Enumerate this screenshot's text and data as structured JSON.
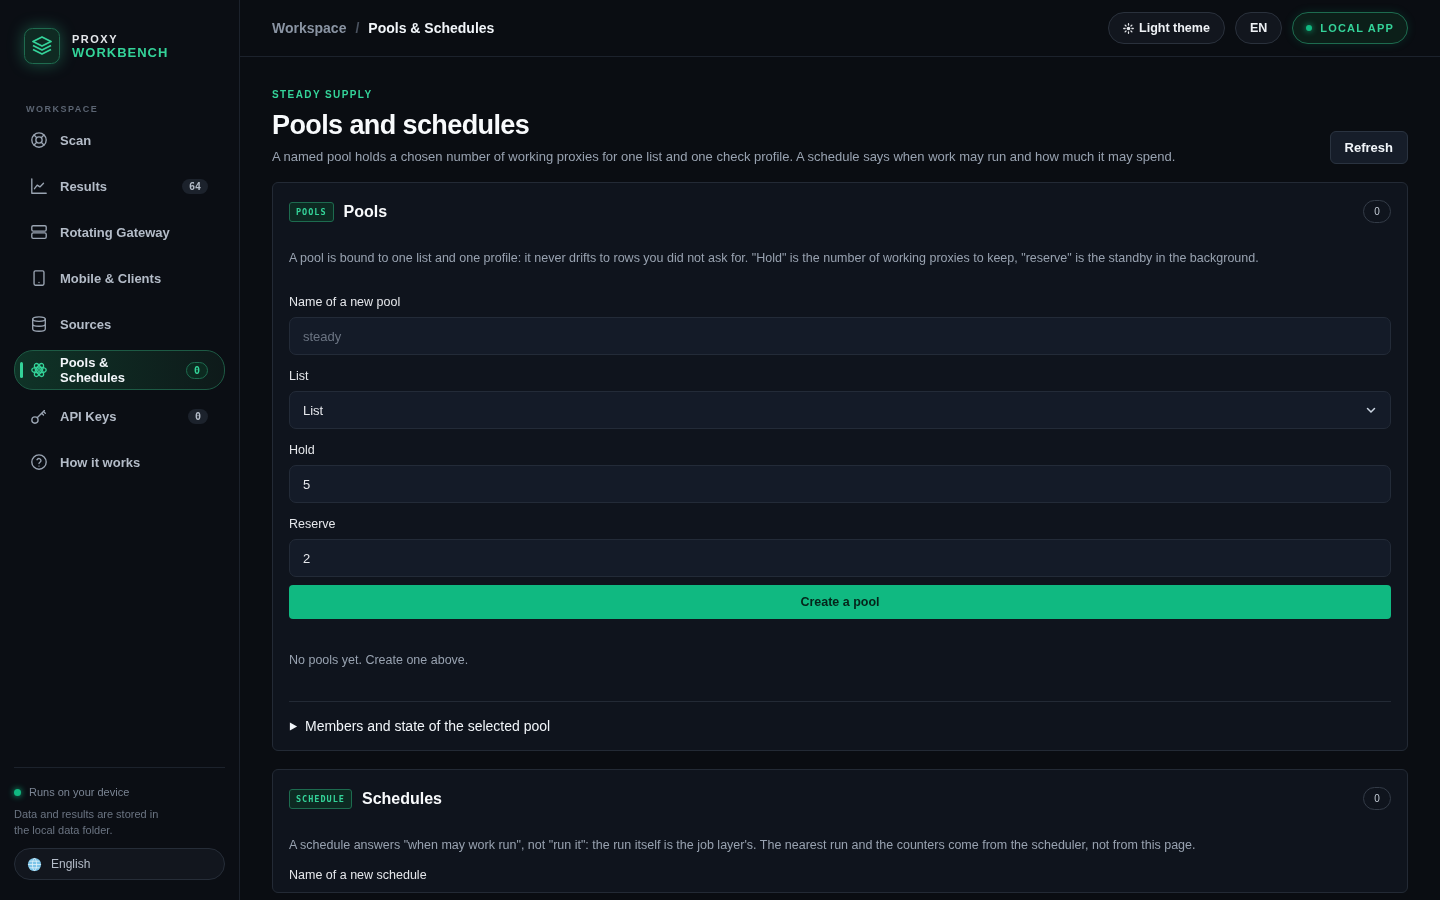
{
  "brand": {
    "line1": "PROXY",
    "line2": "WORKBENCH"
  },
  "sidebar": {
    "section": "WORKSPACE",
    "items": [
      {
        "label": "Scan",
        "selected": false
      },
      {
        "label": "Results",
        "badge": "64",
        "selected": false
      },
      {
        "label": "Rotating Gateway",
        "selected": false
      },
      {
        "label": "Mobile & Clients",
        "selected": false
      },
      {
        "label": "Sources",
        "selected": false
      },
      {
        "label": "Pools & Schedules",
        "badge": "0",
        "selected": true
      },
      {
        "label": "API Keys",
        "badge": "0",
        "selected": false
      },
      {
        "label": "How it works",
        "selected": false
      }
    ],
    "status": "Runs on your device",
    "note": "Data and results are stored in the local data folder.",
    "language": "English"
  },
  "breadcrumb": [
    "Workspace",
    "Pools & Schedules"
  ],
  "breadcrumb_separator": "/",
  "topbar": {
    "theme_button": "Light theme",
    "lang_button": "EN",
    "local_badge": "LOCAL APP"
  },
  "page": {
    "eyebrow": "STEADY SUPPLY",
    "title": "Pools and schedules",
    "description": "A named pool holds a chosen number of working proxies for one list and one check profile. A schedule says when work may run and how much it may spend.",
    "refresh": "Refresh"
  },
  "pools": {
    "tag": "POOLS",
    "title": "Pools",
    "count": "0",
    "description": "A pool is bound to one list and one profile: it never drifts to rows you did not ask for. \"Hold\" is the number of working proxies to keep, \"reserve\" is the standby in the background.",
    "fields": [
      {
        "kind": "text",
        "label": "Name of a new pool",
        "placeholder": "steady"
      },
      {
        "kind": "select",
        "label": "List",
        "value": "List"
      },
      {
        "kind": "text",
        "label": "Hold",
        "value": "5"
      },
      {
        "kind": "text",
        "label": "Reserve",
        "value": "2"
      }
    ],
    "create": "Create a pool",
    "empty": "No pools yet. Create one above.",
    "details": {
      "label": "Members and state of the selected pool",
      "expanded": false
    }
  },
  "schedules": {
    "tag": "SCHEDULE",
    "title": "Schedules",
    "count": "0",
    "description": "A schedule answers \"when may work run\", not \"run it\": the run itself is the job layer's. The nearest run and the counters come from the scheduler, not from this page.",
    "field_label": "Name of a new schedule"
  }
}
